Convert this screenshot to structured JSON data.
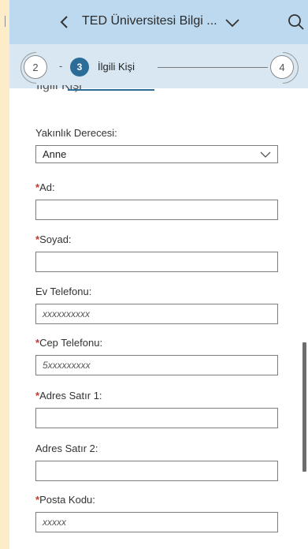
{
  "header": {
    "title": "TED Üniversitesi Bilgi ...",
    "icons": {
      "back": "chevron-left-icon",
      "dropdown": "chevron-down-icon",
      "search": "search-icon"
    }
  },
  "stepper": {
    "prev_step": "2",
    "separator": "-",
    "current_step": "3",
    "current_label": "İlgili Kişi",
    "next_step": "4",
    "accent_color": "#2c6c98"
  },
  "form": {
    "section_title": "İlgili Kişi",
    "required_marker": "*",
    "relation": {
      "label": "Yakınlık Derecesi:",
      "value": "Anne"
    },
    "first_name": {
      "label": "Ad:",
      "value": ""
    },
    "last_name": {
      "label": "Soyad:",
      "value": ""
    },
    "home_phone": {
      "label": "Ev Telefonu:",
      "placeholder": "xxxxxxxxxx"
    },
    "mobile_phone": {
      "label": "Cep Telefonu:",
      "placeholder": "5xxxxxxxxx"
    },
    "address1": {
      "label": "Adres Satır 1:",
      "value": ""
    },
    "address2": {
      "label": "Adres Satır 2:",
      "value": ""
    },
    "postal_code": {
      "label": "Posta Kodu:",
      "placeholder": "xxxxx"
    }
  }
}
